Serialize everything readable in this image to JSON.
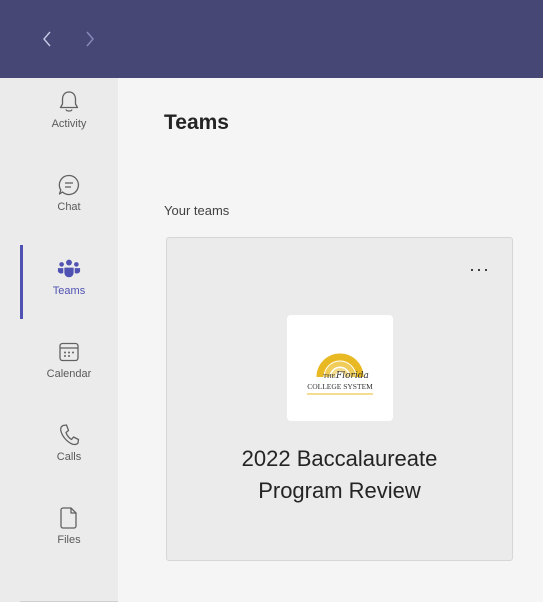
{
  "window": {
    "back_label": "Back",
    "forward_label": "Forward"
  },
  "rail": {
    "items": [
      {
        "label": "Activity",
        "icon": "bell-icon"
      },
      {
        "label": "Chat",
        "icon": "chat-icon"
      },
      {
        "label": "Teams",
        "icon": "teams-icon",
        "active": true
      },
      {
        "label": "Calendar",
        "icon": "calendar-icon"
      },
      {
        "label": "Calls",
        "icon": "phone-icon"
      },
      {
        "label": "Files",
        "icon": "file-icon"
      }
    ]
  },
  "main": {
    "title": "Teams",
    "section_label": "Your teams",
    "teams": [
      {
        "name_line1": "2022 Baccalaureate",
        "name_line2": "Program Review",
        "more_label": "···",
        "logo": {
          "line1": "THE Florida",
          "line2": "COLLEGE SYSTEM"
        }
      }
    ]
  },
  "colors": {
    "topbar": "#464775",
    "accent": "#4f52b2",
    "rail_bg": "#ebebeb",
    "main_bg": "#f5f5f5",
    "logo_gold": "#e8b923"
  }
}
